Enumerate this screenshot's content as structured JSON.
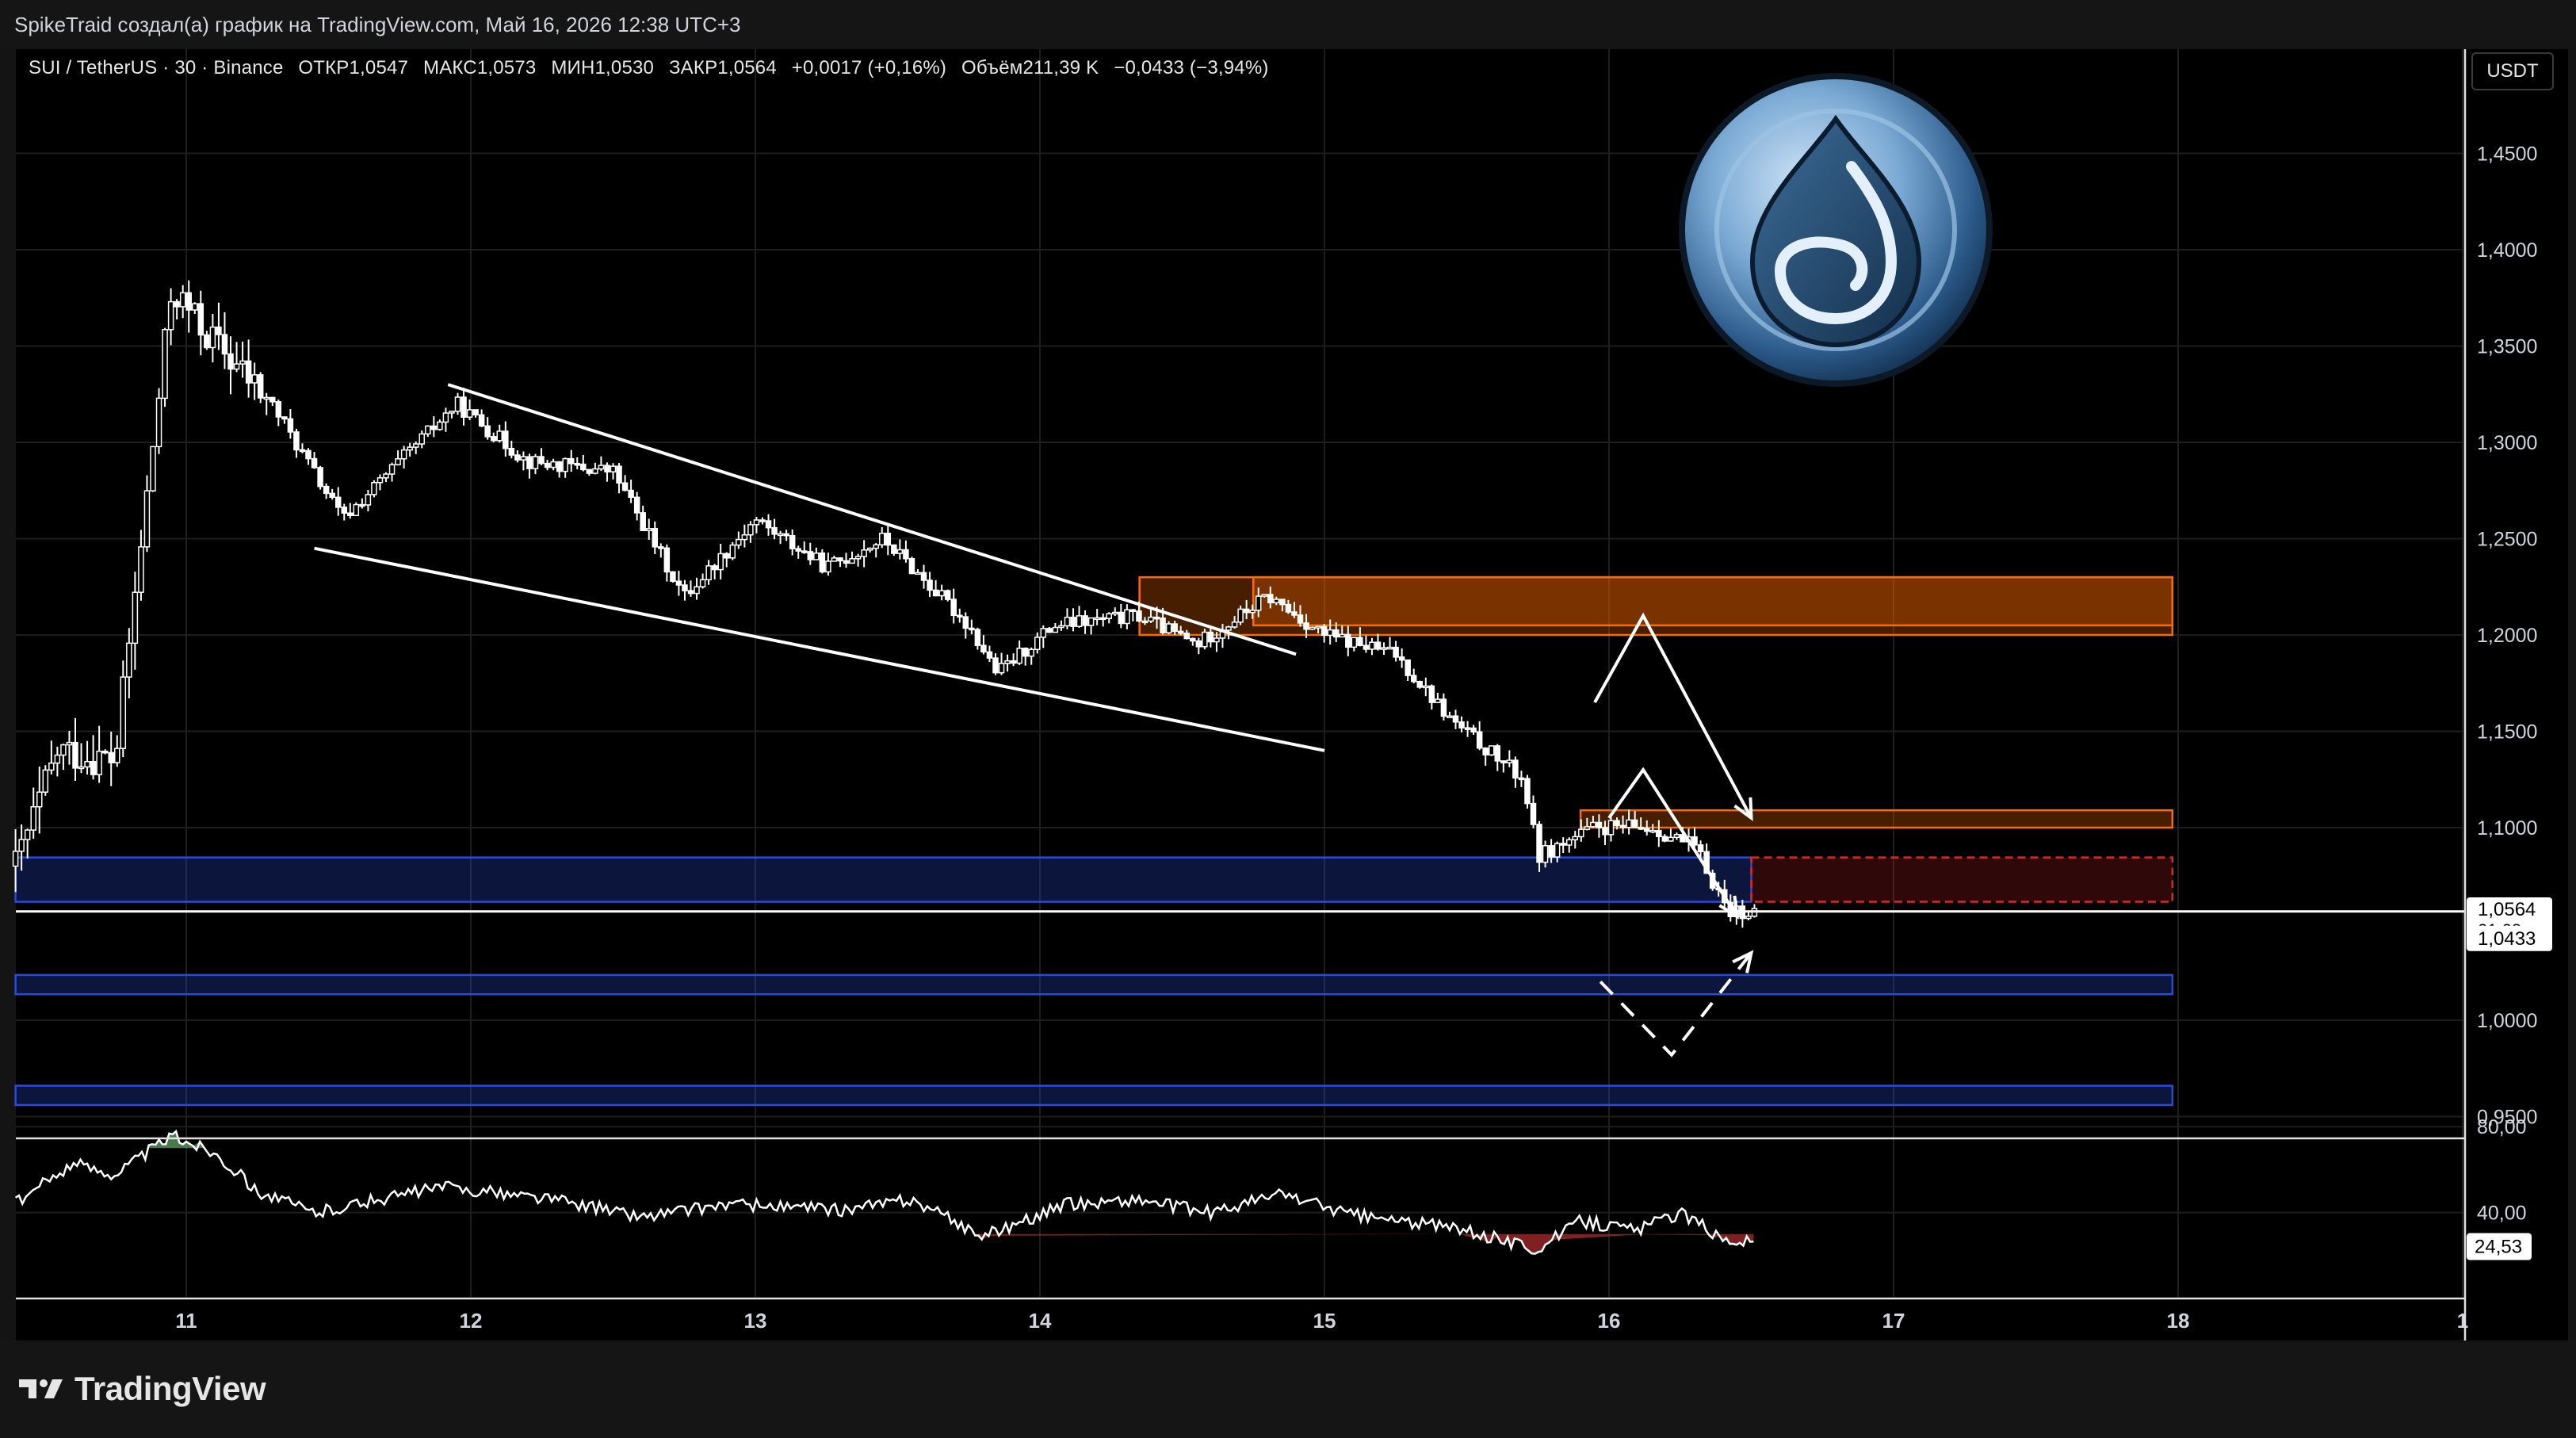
{
  "header": {
    "attribution": "SpikeTraid создал(а) график на TradingView.com, Май 16, 2026 12:38 UTC+3"
  },
  "symbol_info": {
    "symbol": "SUI / TetherUS · 30 · Binance",
    "open": "ОТКР1,0547",
    "high": "МАКС1,0573",
    "low": "МИН1,0530",
    "close": "ЗАКР1,0564",
    "change": "+0,0017 (+0,16%)",
    "volume": "Объём211,39 K",
    "extra": "−0,0433 (−3,94%)"
  },
  "currency": "USDT",
  "footer": {
    "brand": "TradingView"
  },
  "colors": {
    "background": "#000000",
    "candle": "#ffffff",
    "grid": "#1e1e1e",
    "resistance_zone": "#ff6a00",
    "support_zone": "#2b4bd6",
    "target_zone": "#d42a2a",
    "rsi_overbought_fill": "#5a9a5e",
    "rsi_oversold_fill": "#a02828"
  },
  "chart_data": [
    {
      "type": "candlestick",
      "x_ticks": [
        "11",
        "12",
        "13",
        "14",
        "15",
        "16",
        "17",
        "18",
        "1"
      ],
      "y_ticks": [
        "1,4500",
        "1,4000",
        "1,3500",
        "1,3000",
        "1,2500",
        "1,2000",
        "1,1500",
        "1,1000",
        "1,0000",
        "0,9500"
      ],
      "ylim": [
        0.94,
        1.49
      ],
      "price_labels": [
        {
          "value": 1.0564,
          "text": "1,0564",
          "sub": "21:23"
        },
        {
          "value": 1.0433,
          "text": "1,0433"
        }
      ],
      "price_path": [
        {
          "day": 10.4,
          "price": 1.08
        },
        {
          "day": 10.55,
          "price": 1.14
        },
        {
          "day": 10.75,
          "price": 1.135
        },
        {
          "day": 10.95,
          "price": 1.38
        },
        {
          "day": 11.05,
          "price": 1.36
        },
        {
          "day": 11.3,
          "price": 1.32
        },
        {
          "day": 11.55,
          "price": 1.26
        },
        {
          "day": 11.95,
          "price": 1.32
        },
        {
          "day": 12.2,
          "price": 1.29
        },
        {
          "day": 12.5,
          "price": 1.285
        },
        {
          "day": 12.75,
          "price": 1.22
        },
        {
          "day": 13.0,
          "price": 1.26
        },
        {
          "day": 13.25,
          "price": 1.235
        },
        {
          "day": 13.45,
          "price": 1.25
        },
        {
          "day": 13.75,
          "price": 1.205
        },
        {
          "day": 13.85,
          "price": 1.18
        },
        {
          "day": 14.05,
          "price": 1.205
        },
        {
          "day": 14.35,
          "price": 1.21
        },
        {
          "day": 14.55,
          "price": 1.195
        },
        {
          "day": 14.8,
          "price": 1.22
        },
        {
          "day": 15.0,
          "price": 1.2
        },
        {
          "day": 15.25,
          "price": 1.19
        },
        {
          "day": 15.45,
          "price": 1.155
        },
        {
          "day": 15.7,
          "price": 1.125
        },
        {
          "day": 15.75,
          "price": 1.085
        },
        {
          "day": 15.95,
          "price": 1.1
        },
        {
          "day": 16.15,
          "price": 1.1
        },
        {
          "day": 16.3,
          "price": 1.09
        },
        {
          "day": 16.42,
          "price": 1.057
        },
        {
          "day": 16.52,
          "price": 1.0564
        }
      ],
      "trend_lines": [
        {
          "from": {
            "day": 11.92,
            "price": 1.33
          },
          "to": {
            "day": 14.9,
            "price": 1.19
          }
        },
        {
          "from": {
            "day": 11.45,
            "price": 1.245
          },
          "to": {
            "day": 15.0,
            "price": 1.14
          }
        }
      ],
      "zones": [
        {
          "kind": "resistance",
          "from_day": 14.35,
          "to_day": 17.98,
          "low": 1.2,
          "high": 1.23
        },
        {
          "kind": "resistance",
          "from_day": 14.75,
          "to_day": 17.98,
          "low": 1.205,
          "high": 1.23
        },
        {
          "kind": "resistance",
          "from_day": 15.9,
          "to_day": 17.98,
          "low": 1.1,
          "high": 1.109
        },
        {
          "kind": "support",
          "from_day": 10.4,
          "to_day": 16.5,
          "low": 1.0615,
          "high": 1.0845
        },
        {
          "kind": "target",
          "from_day": 16.5,
          "to_day": 17.98,
          "low": 1.0615,
          "high": 1.0845
        },
        {
          "kind": "support",
          "from_day": 10.4,
          "to_day": 17.98,
          "low": 1.0135,
          "high": 1.0235
        },
        {
          "kind": "support",
          "from_day": 10.4,
          "to_day": 17.98,
          "low": 0.956,
          "high": 0.966
        }
      ],
      "projections": [
        {
          "style": "solid",
          "points": [
            [
              15.95,
              1.165
            ],
            [
              16.12,
              1.21
            ],
            [
              16.5,
              1.105
            ]
          ]
        },
        {
          "style": "solid",
          "points": [
            [
              16.0,
              1.105
            ],
            [
              16.12,
              1.13
            ],
            [
              16.45,
              1.054
            ]
          ]
        },
        {
          "style": "dashed",
          "points": [
            [
              15.97,
              1.02
            ],
            [
              16.22,
              0.982
            ],
            [
              16.5,
              1.035
            ]
          ]
        }
      ]
    },
    {
      "type": "line",
      "name": "RSI",
      "y_ticks": [
        "80,00",
        "40,00"
      ],
      "current_label": "24,53",
      "ylim": [
        0,
        100
      ],
      "points": [
        {
          "day": 10.4,
          "value": 44
        },
        {
          "day": 10.6,
          "value": 63
        },
        {
          "day": 10.75,
          "value": 58
        },
        {
          "day": 10.95,
          "value": 76
        },
        {
          "day": 11.1,
          "value": 68
        },
        {
          "day": 11.25,
          "value": 50
        },
        {
          "day": 11.45,
          "value": 40
        },
        {
          "day": 11.9,
          "value": 52
        },
        {
          "day": 12.3,
          "value": 46
        },
        {
          "day": 12.6,
          "value": 38
        },
        {
          "day": 12.9,
          "value": 44
        },
        {
          "day": 13.3,
          "value": 41
        },
        {
          "day": 13.55,
          "value": 46
        },
        {
          "day": 13.8,
          "value": 29
        },
        {
          "day": 14.1,
          "value": 44
        },
        {
          "day": 14.35,
          "value": 46
        },
        {
          "day": 14.6,
          "value": 40
        },
        {
          "day": 14.85,
          "value": 49
        },
        {
          "day": 15.1,
          "value": 39
        },
        {
          "day": 15.45,
          "value": 33
        },
        {
          "day": 15.75,
          "value": 23
        },
        {
          "day": 15.9,
          "value": 36
        },
        {
          "day": 16.1,
          "value": 32
        },
        {
          "day": 16.25,
          "value": 40
        },
        {
          "day": 16.4,
          "value": 28
        },
        {
          "day": 16.52,
          "value": 26
        }
      ]
    }
  ]
}
